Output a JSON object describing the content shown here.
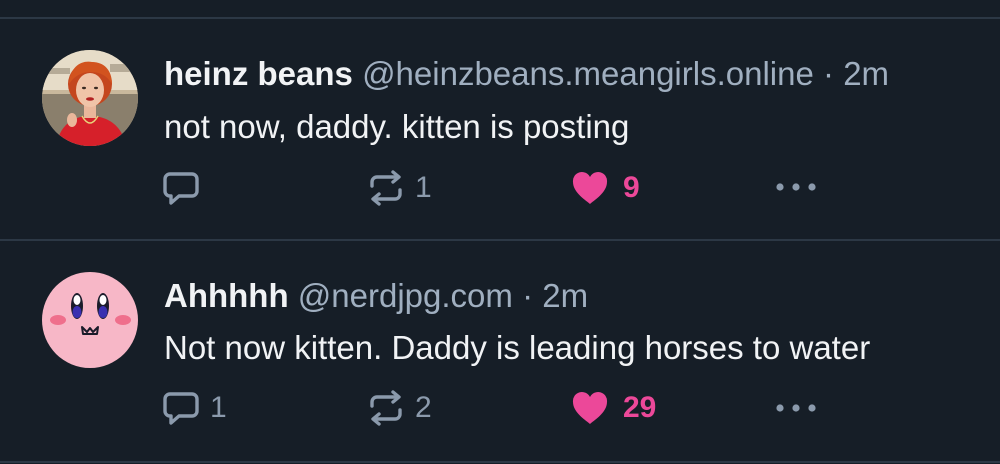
{
  "posts": [
    {
      "display_name": "heinz beans",
      "handle": "@heinzbeans.meangirls.online",
      "separator": "·",
      "time": "2m",
      "text": "not now, daddy. kitten is posting",
      "reply_count": "",
      "repost_count": "1",
      "like_count": "9",
      "avatar_icon": "redhead-woman-avatar"
    },
    {
      "display_name": "Ahhhhh",
      "handle": "@nerdjpg.com",
      "separator": "·",
      "time": "2m",
      "text": "Not now kitten. Daddy is leading horses to water",
      "reply_count": "1",
      "repost_count": "2",
      "like_count": "29",
      "avatar_icon": "kirby-face-avatar"
    }
  ],
  "colors": {
    "background": "#161e27",
    "divider": "#2c3845",
    "text": "#f1f3f5",
    "muted": "#a0afc0",
    "action": "#8b9aac",
    "like": "#ec4899"
  }
}
